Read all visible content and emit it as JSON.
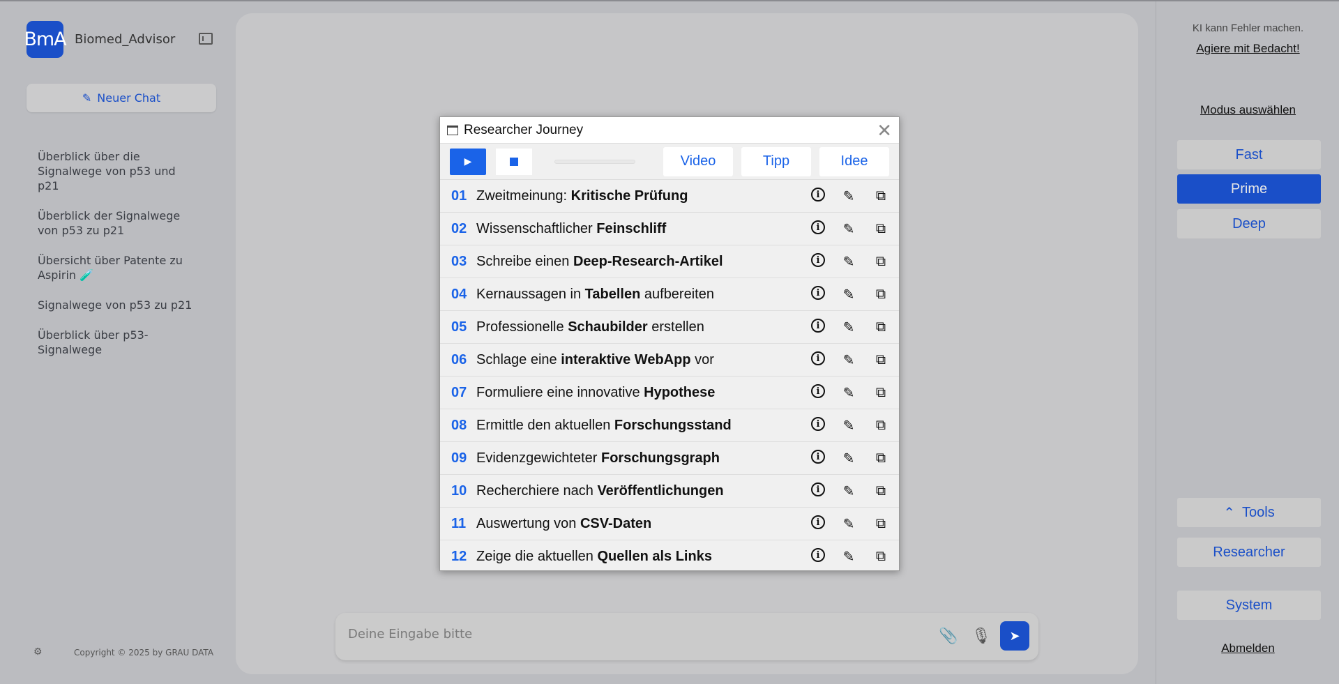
{
  "app": {
    "logo": "BmA",
    "title": "Biomed_Advisor",
    "new_chat": "Neuer Chat",
    "copyright": "Copyright © 2025 by GRAU DATA"
  },
  "history": [
    "Überblick über die Signalwege von p53 und p21",
    "Überblick der Signalwege von p53 zu p21",
    "Übersicht über Patente zu Aspirin 🧪",
    "Signalwege von p53 zu p21",
    "Überblick über p53-Signalwege"
  ],
  "input": {
    "placeholder": "Deine Eingabe bitte"
  },
  "right": {
    "warning": "KI kann Fehler machen.",
    "caution_link": "Agiere mit Bedacht!",
    "mode_label": "Modus auswählen",
    "modes": [
      "Fast",
      "Prime",
      "Deep"
    ],
    "active_mode": "Prime",
    "tools": "Tools",
    "researcher": "Researcher",
    "system": "System",
    "logout": "Abmelden"
  },
  "modal": {
    "title": "Researcher Journey",
    "progress": 0,
    "buttons": [
      "Video",
      "Tipp",
      "Idee"
    ],
    "rows": [
      {
        "n": "01",
        "pre": "Zweitmeinung: ",
        "bold": "Kritische Prüfung",
        "post": ""
      },
      {
        "n": "02",
        "pre": "Wissenschaftlicher ",
        "bold": "Feinschliff",
        "post": ""
      },
      {
        "n": "03",
        "pre": "Schreibe einen ",
        "bold": "Deep-Research-Artikel",
        "post": ""
      },
      {
        "n": "04",
        "pre": "Kernaussagen in ",
        "bold": "Tabellen",
        "post": " aufbereiten"
      },
      {
        "n": "05",
        "pre": "Professionelle ",
        "bold": "Schaubilder",
        "post": " erstellen"
      },
      {
        "n": "06",
        "pre": "Schlage eine ",
        "bold": "interaktive WebApp",
        "post": " vor"
      },
      {
        "n": "07",
        "pre": "Formuliere eine innovative ",
        "bold": "Hypothese",
        "post": ""
      },
      {
        "n": "08",
        "pre": "Ermittle den aktuellen ",
        "bold": "Forschungsstand",
        "post": ""
      },
      {
        "n": "09",
        "pre": "Evidenzgewichteter ",
        "bold": "Forschungsgraph",
        "post": ""
      },
      {
        "n": "10",
        "pre": "Recherchiere nach ",
        "bold": "Veröffentlichungen",
        "post": ""
      },
      {
        "n": "11",
        "pre": "Auswertung von ",
        "bold": "CSV-Daten",
        "post": ""
      },
      {
        "n": "12",
        "pre": "Zeige die aktuellen ",
        "bold": "Quellen als Links",
        "post": ""
      }
    ]
  },
  "colors": {
    "accent": "#1a4fc8",
    "modal_accent": "#1a63e8"
  }
}
